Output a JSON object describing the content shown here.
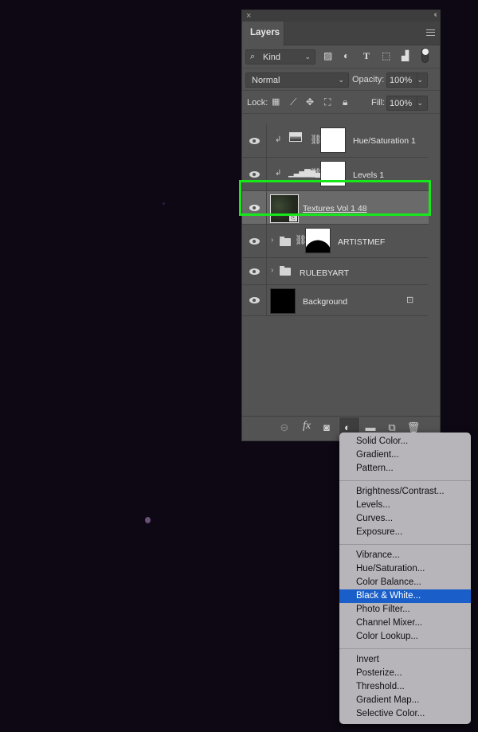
{
  "panel": {
    "close_glyph": "×",
    "collapse_glyph": "‹‹",
    "tab_label": "Layers",
    "menu_icon": "hamburger-menu-icon"
  },
  "filter": {
    "kind_label": "Kind",
    "icons": [
      "image-filter-icon",
      "adjustment-filter-icon",
      "type-filter-icon",
      "shape-filter-icon",
      "smart-object-filter-icon"
    ],
    "toggle_on": true
  },
  "blend": {
    "mode": "Normal",
    "opacity_label": "Opacity:",
    "opacity_value": "100%"
  },
  "lock": {
    "label": "Lock:",
    "icons": [
      "lock-transparent-icon",
      "lock-paint-icon",
      "lock-position-icon",
      "lock-artboard-icon",
      "lock-all-icon"
    ],
    "fill_label": "Fill:",
    "fill_value": "100%"
  },
  "layers": [
    {
      "name": "Hue/Saturation 1",
      "type": "adjustment",
      "clipped": true,
      "visible": true
    },
    {
      "name": "Levels 1",
      "type": "adjustment",
      "clipped": true,
      "visible": true
    },
    {
      "name": "Textures Vol 1 48",
      "type": "smart-object",
      "selected": true,
      "visible": true
    },
    {
      "name": "ARTISTMEF",
      "type": "group-masked",
      "visible": true
    },
    {
      "name": "RULEBYART",
      "type": "group",
      "visible": true
    },
    {
      "name": "Background",
      "type": "background",
      "locked": true,
      "visible": true
    }
  ],
  "bottom_bar": {
    "icons": [
      "link-layers-icon",
      "fx-icon",
      "add-mask-icon",
      "new-adjustment-layer-icon",
      "new-group-icon",
      "new-layer-icon",
      "delete-layer-icon"
    ],
    "fx_label": "fx"
  },
  "adjustment_menu": {
    "groups": [
      [
        "Solid Color...",
        "Gradient...",
        "Pattern..."
      ],
      [
        "Brightness/Contrast...",
        "Levels...",
        "Curves...",
        "Exposure..."
      ],
      [
        "Vibrance...",
        "Hue/Saturation...",
        "Color Balance...",
        "Black & White...",
        "Photo Filter...",
        "Channel Mixer...",
        "Color Lookup..."
      ],
      [
        "Invert",
        "Posterize...",
        "Threshold...",
        "Gradient Map...",
        "Selective Color..."
      ]
    ],
    "highlighted": "Black & White...",
    "highlight_color": "#1a5fc9"
  },
  "colors": {
    "selection_outline": "#17e81a",
    "panel_bg": "#535353"
  }
}
